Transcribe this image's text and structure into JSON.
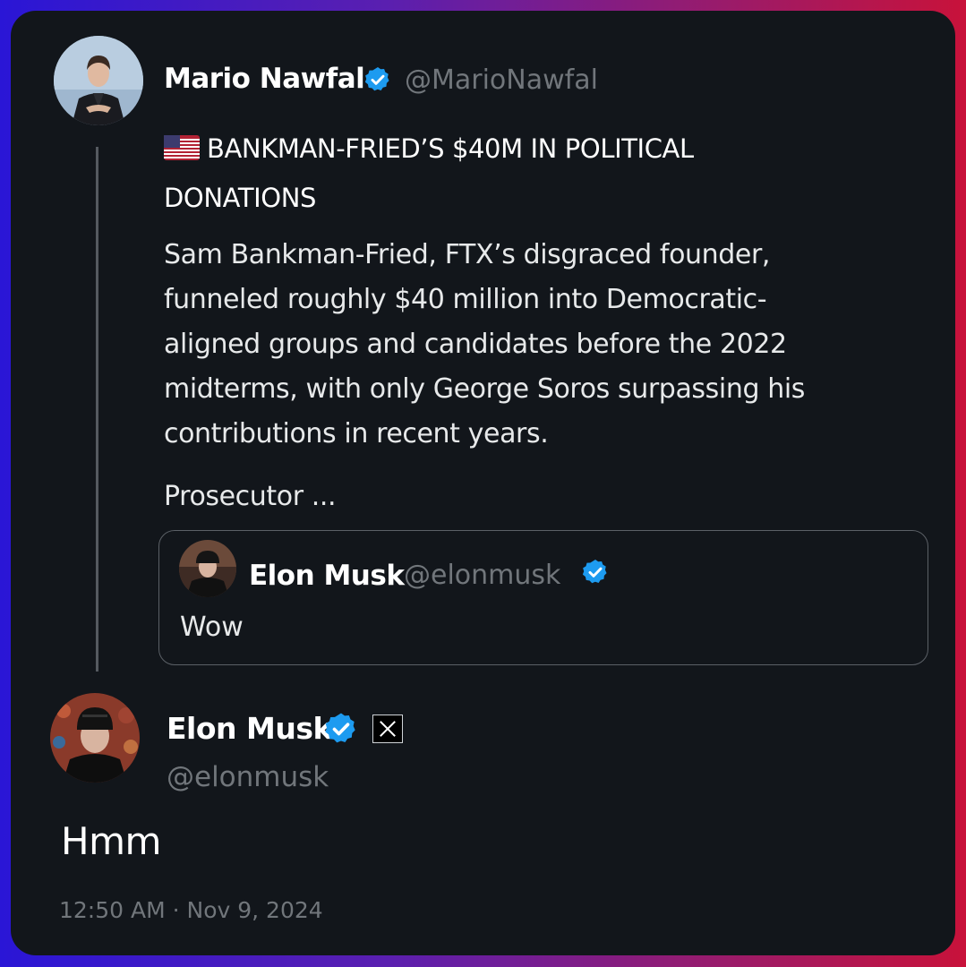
{
  "original_tweet": {
    "author_name": "Mario Nawfal",
    "author_handle": "@MarioNawfal",
    "flag_icon": "us-flag-icon",
    "headline": "BANKMAN-FRIED’S $40M IN POLITICAL DONATIONS",
    "body": "Sam Bankman-Fried, FTX’s disgraced founder, funneled roughly $40 million into Democratic-aligned groups and candidates before the 2022 midterms, with only George Soros surpassing his contributions in recent years.",
    "truncated_text": "Prosecutor ..."
  },
  "quoted_tweet": {
    "author_name": "Elon Musk",
    "author_handle": "@elonmusk",
    "text": "Wow"
  },
  "reply": {
    "author_name": "Elon Musk",
    "author_handle": "@elonmusk",
    "text": "Hmm",
    "timestamp": "12:50 AM · Nov 9, 2024"
  },
  "colors": {
    "verified_blue": "#1d9bf0",
    "card_background": "#12161b",
    "muted_text": "#71767b"
  }
}
